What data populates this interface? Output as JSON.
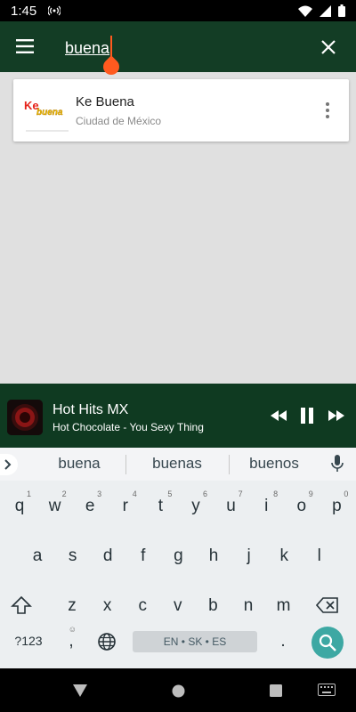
{
  "status_bar": {
    "time": "1:45",
    "icons": [
      "cast-icon",
      "wifi-icon",
      "signal-icon",
      "battery-icon"
    ]
  },
  "search": {
    "value": "buena",
    "menu_icon": "menu-icon",
    "clear_icon": "close-icon"
  },
  "results": [
    {
      "name": "Ke Buena",
      "city": "Ciudad de México",
      "logo_text_1": "Ke",
      "logo_text_2": "buena",
      "more_icon": "more-vert-icon"
    }
  ],
  "player": {
    "station": "Hot Hits MX",
    "now_playing": "Hot Chocolate - You Sexy Thing",
    "controls": [
      "rewind-icon",
      "pause-icon",
      "fast-forward-icon"
    ]
  },
  "keyboard": {
    "suggestions": [
      "buena",
      "buenas",
      "buenos"
    ],
    "row1": [
      {
        "k": "q",
        "n": "1"
      },
      {
        "k": "w",
        "n": "2"
      },
      {
        "k": "e",
        "n": "3"
      },
      {
        "k": "r",
        "n": "4"
      },
      {
        "k": "t",
        "n": "5"
      },
      {
        "k": "y",
        "n": "6"
      },
      {
        "k": "u",
        "n": "7"
      },
      {
        "k": "i",
        "n": "8"
      },
      {
        "k": "o",
        "n": "9"
      },
      {
        "k": "p",
        "n": "0"
      }
    ],
    "row2": [
      "a",
      "s",
      "d",
      "f",
      "g",
      "h",
      "j",
      "k",
      "l"
    ],
    "row3": [
      "z",
      "x",
      "c",
      "v",
      "b",
      "n",
      "m"
    ],
    "symbols_label": "?123",
    "comma": ",",
    "space_label": "EN • SK • ES",
    "period": "."
  },
  "colors": {
    "app_bar": "#133d25",
    "player_bg": "#0f3a21",
    "accent": "#ff5a1f",
    "search_key": "#3da8a3"
  }
}
